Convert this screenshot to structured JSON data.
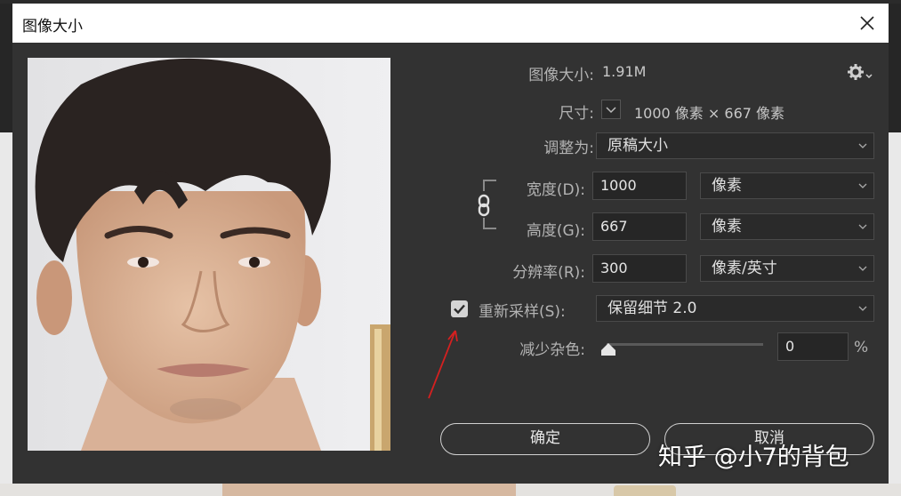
{
  "dialog": {
    "title": "图像大小"
  },
  "info": {
    "image_size_label": "图像大小:",
    "image_size_value": "1.91M",
    "dimensions_label": "尺寸:",
    "dimensions_value": "1000 像素  ×  667 像素"
  },
  "fit_to": {
    "label": "调整为:",
    "value": "原稿大小"
  },
  "width": {
    "label": "宽度(D):",
    "value": "1000",
    "unit": "像素"
  },
  "height": {
    "label": "高度(G):",
    "value": "667",
    "unit": "像素"
  },
  "resolution": {
    "label": "分辨率(R):",
    "value": "300",
    "unit": "像素/英寸"
  },
  "resample": {
    "label": "重新采样(S):",
    "checked": true,
    "method": "保留细节 2.0"
  },
  "noise": {
    "label": "减少杂色:",
    "value": "0",
    "unit": "%",
    "level": 0
  },
  "buttons": {
    "ok": "确定",
    "cancel": "取消"
  },
  "watermark": "知乎 @小7的背包",
  "colors": {
    "dialog_bg": "#323232",
    "annotation_arrow": "#d42020"
  }
}
